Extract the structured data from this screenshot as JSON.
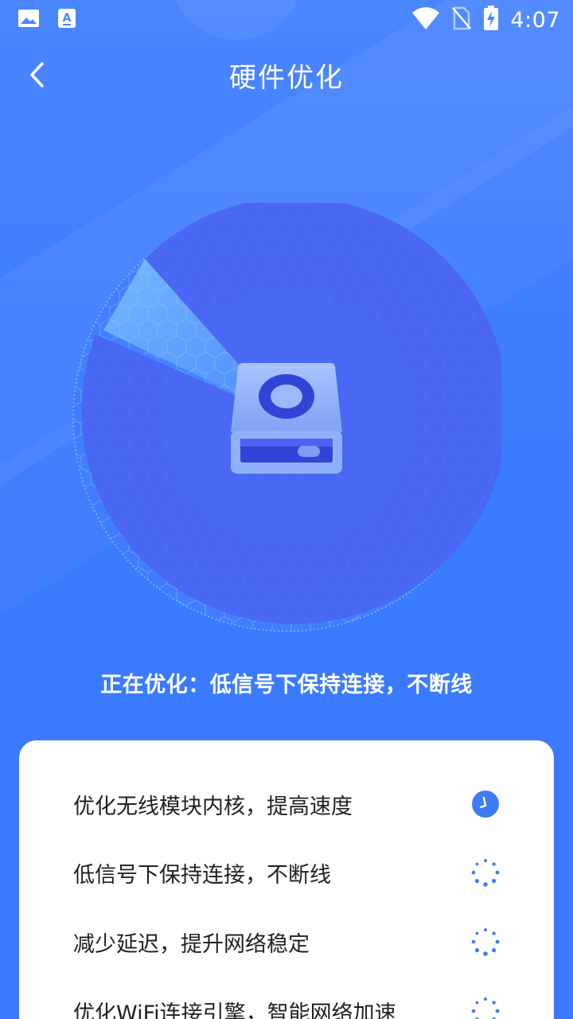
{
  "status_bar": {
    "time": "4:07",
    "left_icons": [
      "image-icon",
      "text-app-icon"
    ],
    "right_icons": [
      "wifi-icon",
      "no-sim-icon",
      "battery-charging-icon"
    ]
  },
  "header": {
    "back_icon": "chevron-left-icon",
    "title": "硬件优化"
  },
  "scanner": {
    "icon": "hard-drive-icon",
    "status_text": "正在优化：低信号下保持连接，不断线"
  },
  "tasks": [
    {
      "label": "优化无线模块内核，提高速度",
      "status": "done",
      "status_icon": "clock-check-icon"
    },
    {
      "label": "低信号下保持连接，不断线",
      "status": "loading",
      "status_icon": "spinner-icon"
    },
    {
      "label": "减少延迟，提升网络稳定",
      "status": "loading",
      "status_icon": "spinner-icon"
    },
    {
      "label": "优化WiFi连接引擎，智能网络加速",
      "status": "loading",
      "status_icon": "spinner-icon"
    }
  ],
  "colors": {
    "background": "#3d7cff",
    "accent": "#3e7bf6",
    "sweep": "#4a63f2",
    "card": "#ffffff",
    "task_text": "#222222"
  }
}
